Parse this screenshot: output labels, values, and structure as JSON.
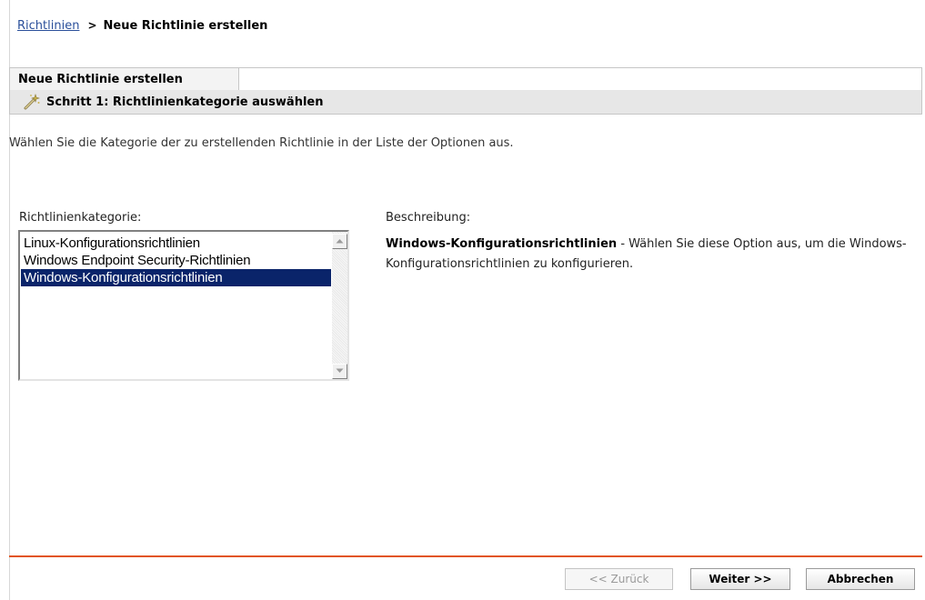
{
  "breadcrumb": {
    "parent": "Richtlinien",
    "separator": ">",
    "current": "Neue Richtlinie erstellen"
  },
  "panel": {
    "title": "Neue Richtlinie erstellen",
    "step": "Schritt 1: Richtlinienkategorie auswählen",
    "step_icon": "wand-icon"
  },
  "instruction": "Wählen Sie die Kategorie der zu erstellenden Richtlinie in der Liste der Optionen aus.",
  "category": {
    "label": "Richtlinienkategorie:",
    "items": [
      "Linux-Konfigurationsrichtlinien",
      "Windows Endpoint Security-Richtlinien",
      "Windows-Konfigurationsrichtlinien"
    ],
    "selected_index": 2
  },
  "description": {
    "label": "Beschreibung:",
    "title": "Windows-Konfigurationsrichtlinien",
    "text": " - Wählen Sie diese Option aus, um die Windows-Konfigurationsrichtlinien zu konfigurieren."
  },
  "buttons": {
    "back": "<< Zurück",
    "next": "Weiter >>",
    "cancel": "Abbrechen"
  },
  "colors": {
    "accent_rule": "#e2541d",
    "link": "#2a4f9a",
    "selection": "#0a246a"
  }
}
